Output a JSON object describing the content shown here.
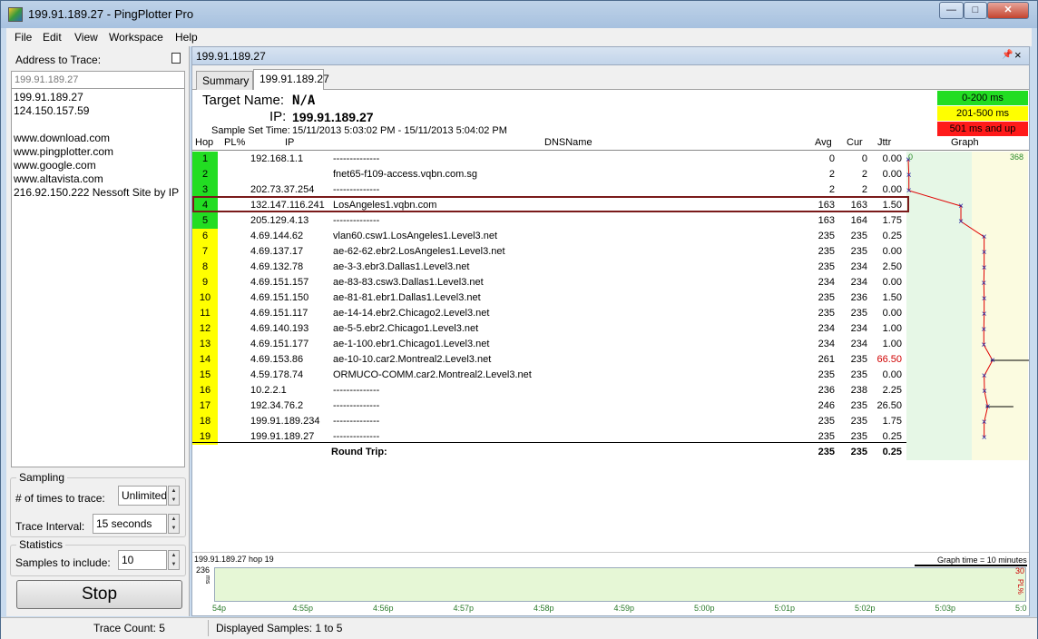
{
  "window": {
    "title": "199.91.189.27 - PingPlotter Pro"
  },
  "menu": [
    "File",
    "Edit",
    "View",
    "Workspace",
    "Help"
  ],
  "left": {
    "address_label": "Address to Trace:",
    "address_value": "199.91.189.27",
    "history": [
      "199.91.189.27",
      "124.150.157.59",
      "",
      "www.download.com",
      "www.pingplotter.com",
      "www.google.com",
      "www.altavista.com",
      "216.92.150.222 Nessoft Site by IP"
    ],
    "sampling_title": "Sampling",
    "times_label": "# of times to trace:",
    "times_value": "Unlimited",
    "interval_label": "Trace Interval:",
    "interval_value": "15 seconds",
    "statistics_title": "Statistics",
    "samples_label": "Samples to include:",
    "samples_value": "10",
    "stop_label": "Stop"
  },
  "doc": {
    "title": "199.91.189.27",
    "tabs": [
      "Summary",
      "199.91.189.27"
    ],
    "target_name_label": "Target Name:",
    "target_name_value": "N/A",
    "ip_label": "IP:",
    "ip_value": "199.91.189.27",
    "sample_set_label": "Sample Set Time:",
    "sample_set_value": "15/11/2013 5:03:02 PM - 15/11/2013 5:04:02 PM",
    "legend": [
      {
        "label": "0-200 ms",
        "color": "#22dd22"
      },
      {
        "label": "201-500 ms",
        "color": "#ffff00"
      },
      {
        "label": "501 ms and up",
        "color": "#ff1a1a"
      }
    ]
  },
  "table": {
    "headers": {
      "hop": "Hop",
      "pl": "PL%",
      "ip": "IP",
      "dns": "DNSName",
      "avg": "Avg",
      "cur": "Cur",
      "jttr": "Jttr",
      "graph": "Graph"
    },
    "graph_min": "0",
    "graph_max": "368",
    "rows": [
      {
        "hop": "1",
        "ip": "192.168.1.1",
        "dns": "--------------",
        "avg": "0",
        "cur": "0",
        "jttr": "0.00",
        "color": "#22dd22"
      },
      {
        "hop": "2",
        "ip": "",
        "dns": "fnet65-f109-access.vqbn.com.sg",
        "avg": "2",
        "cur": "2",
        "jttr": "0.00",
        "color": "#22dd22"
      },
      {
        "hop": "3",
        "ip": "202.73.37.254",
        "dns": "--------------",
        "avg": "2",
        "cur": "2",
        "jttr": "0.00",
        "color": "#22dd22"
      },
      {
        "hop": "4",
        "ip": "132.147.116.241",
        "dns": "LosAngeles1.vqbn.com",
        "avg": "163",
        "cur": "163",
        "jttr": "1.50",
        "color": "#22dd22"
      },
      {
        "hop": "5",
        "ip": "205.129.4.13",
        "dns": "--------------",
        "avg": "163",
        "cur": "164",
        "jttr": "1.75",
        "color": "#22dd22"
      },
      {
        "hop": "6",
        "ip": "4.69.144.62",
        "dns": "vlan60.csw1.LosAngeles1.Level3.net",
        "avg": "235",
        "cur": "235",
        "jttr": "0.25",
        "color": "#ffff00"
      },
      {
        "hop": "7",
        "ip": "4.69.137.17",
        "dns": "ae-62-62.ebr2.LosAngeles1.Level3.net",
        "avg": "235",
        "cur": "235",
        "jttr": "0.00",
        "color": "#ffff00"
      },
      {
        "hop": "8",
        "ip": "4.69.132.78",
        "dns": "ae-3-3.ebr3.Dallas1.Level3.net",
        "avg": "235",
        "cur": "234",
        "jttr": "2.50",
        "color": "#ffff00"
      },
      {
        "hop": "9",
        "ip": "4.69.151.157",
        "dns": "ae-83-83.csw3.Dallas1.Level3.net",
        "avg": "234",
        "cur": "234",
        "jttr": "0.00",
        "color": "#ffff00"
      },
      {
        "hop": "10",
        "ip": "4.69.151.150",
        "dns": "ae-81-81.ebr1.Dallas1.Level3.net",
        "avg": "235",
        "cur": "236",
        "jttr": "1.50",
        "color": "#ffff00"
      },
      {
        "hop": "11",
        "ip": "4.69.151.117",
        "dns": "ae-14-14.ebr2.Chicago2.Level3.net",
        "avg": "235",
        "cur": "235",
        "jttr": "0.00",
        "color": "#ffff00"
      },
      {
        "hop": "12",
        "ip": "4.69.140.193",
        "dns": "ae-5-5.ebr2.Chicago1.Level3.net",
        "avg": "234",
        "cur": "234",
        "jttr": "1.00",
        "color": "#ffff00"
      },
      {
        "hop": "13",
        "ip": "4.69.151.177",
        "dns": "ae-1-100.ebr1.Chicago1.Level3.net",
        "avg": "234",
        "cur": "234",
        "jttr": "1.00",
        "color": "#ffff00"
      },
      {
        "hop": "14",
        "ip": "4.69.153.86",
        "dns": "ae-10-10.car2.Montreal2.Level3.net",
        "avg": "261",
        "cur": "235",
        "jttr": "66.50",
        "color": "#ffff00",
        "jttr_color": "#d00000"
      },
      {
        "hop": "15",
        "ip": "4.59.178.74",
        "dns": "ORMUCO-COMM.car2.Montreal2.Level3.net",
        "avg": "235",
        "cur": "235",
        "jttr": "0.00",
        "color": "#ffff00"
      },
      {
        "hop": "16",
        "ip": "10.2.2.1",
        "dns": "--------------",
        "avg": "236",
        "cur": "238",
        "jttr": "2.25",
        "color": "#ffff00"
      },
      {
        "hop": "17",
        "ip": "192.34.76.2",
        "dns": "--------------",
        "avg": "246",
        "cur": "235",
        "jttr": "26.50",
        "color": "#ffff00"
      },
      {
        "hop": "18",
        "ip": "199.91.189.234",
        "dns": "--------------",
        "avg": "235",
        "cur": "235",
        "jttr": "1.75",
        "color": "#ffff00"
      },
      {
        "hop": "19",
        "ip": "199.91.189.27",
        "dns": "--------------",
        "avg": "235",
        "cur": "235",
        "jttr": "0.25",
        "color": "#ffff00"
      }
    ],
    "round_trip_label": "Round Trip:",
    "round_trip": {
      "avg": "235",
      "cur": "235",
      "jttr": "0.25"
    }
  },
  "time_graph": {
    "title": "199.91.189.27 hop 19",
    "graph_time": "Graph time = 10 minutes",
    "y_max": "236",
    "y_unit": "ms",
    "pl_max": "30",
    "pl_unit": "PL%",
    "ticks": [
      "54p",
      "4:55p",
      "4:56p",
      "4:57p",
      "4:58p",
      "4:59p",
      "5:00p",
      "5:01p",
      "5:02p",
      "5:03p",
      "5:0"
    ]
  },
  "status": {
    "trace_count": "Trace Count: 5",
    "displayed_samples": "Displayed Samples: 1 to 5"
  }
}
